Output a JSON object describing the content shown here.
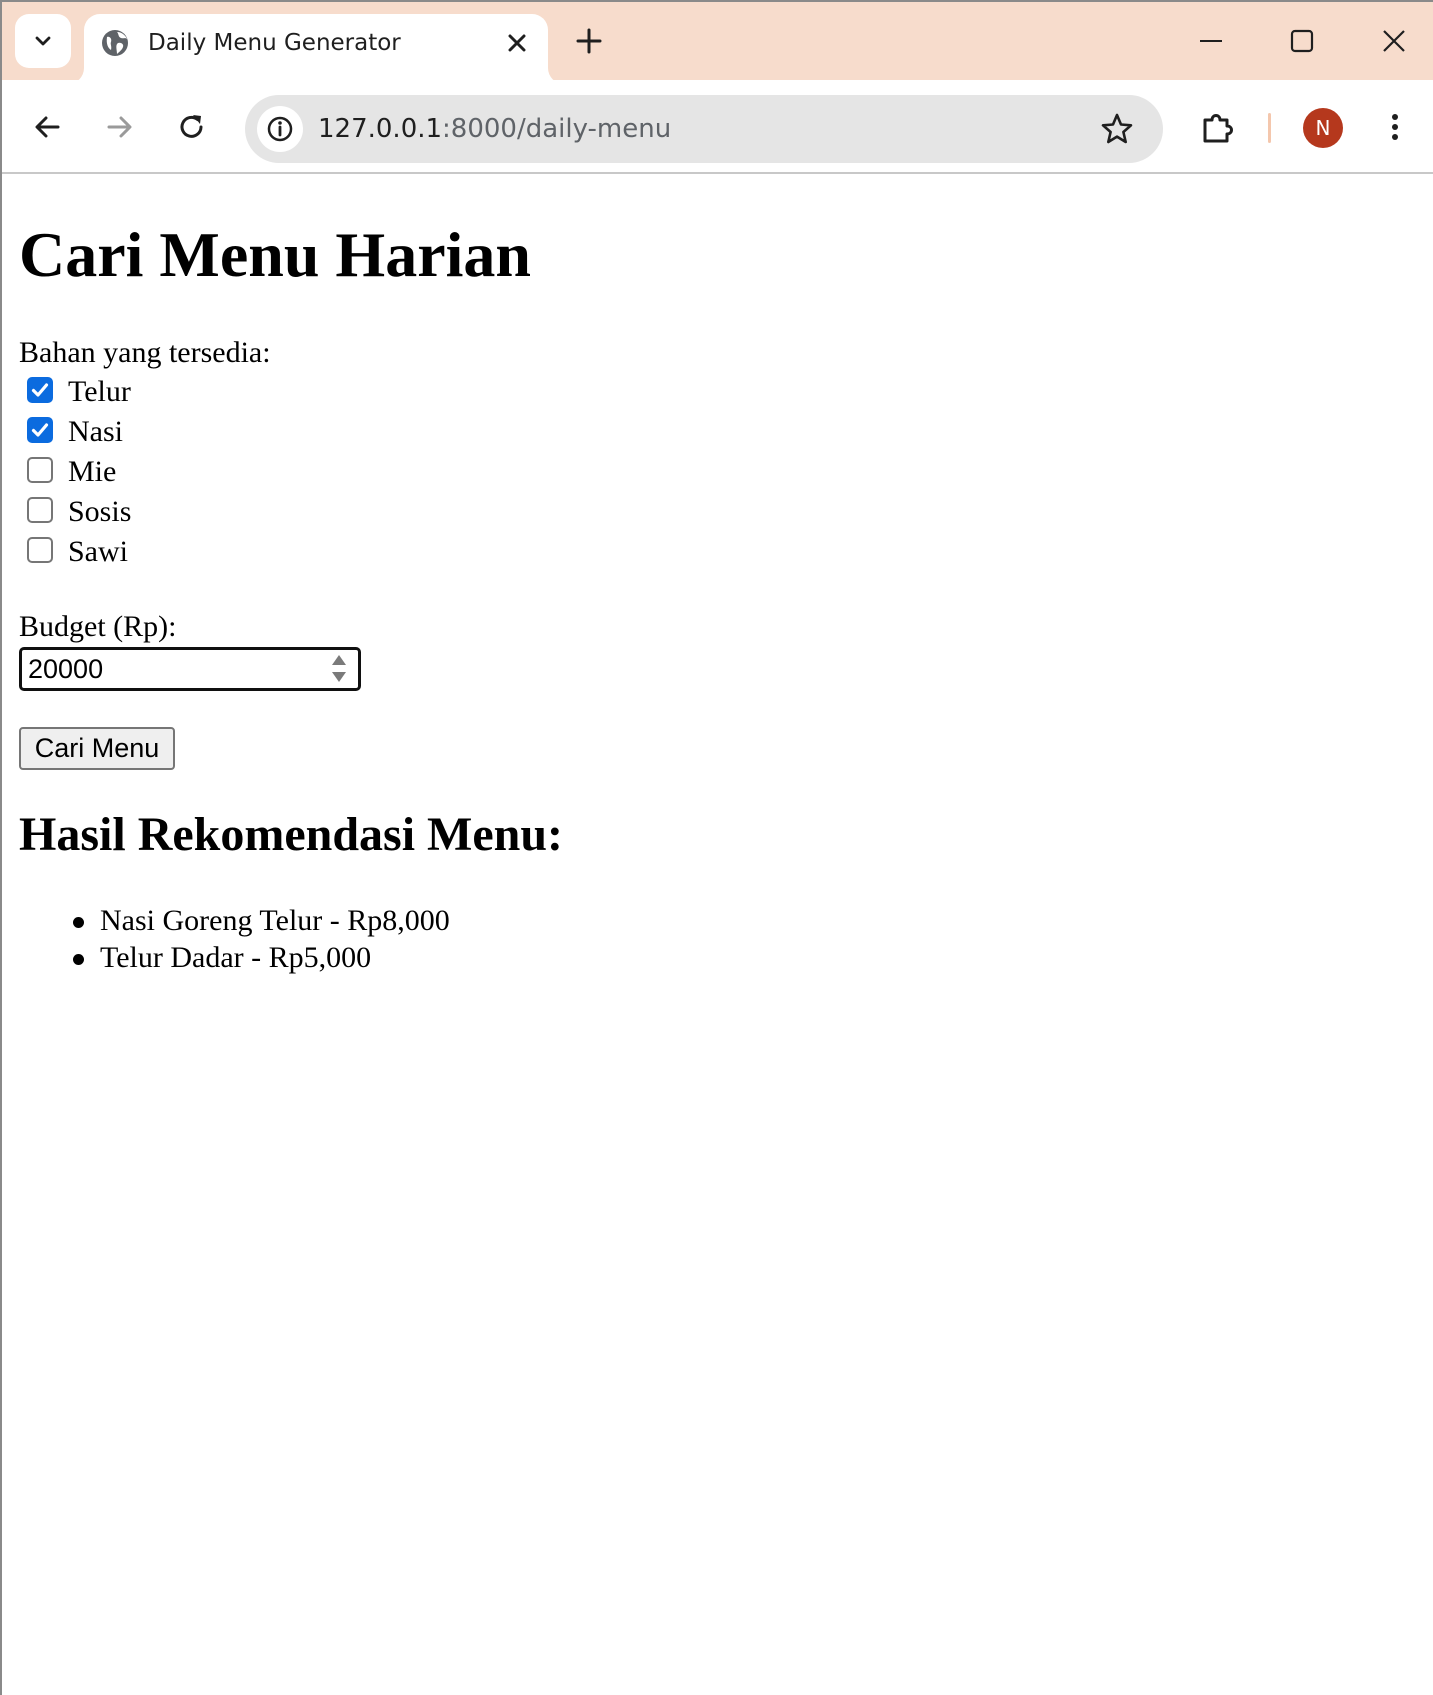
{
  "browser": {
    "tab": {
      "title": "Daily Menu Generator",
      "favicon": "globe-icon"
    },
    "address_bar": {
      "host": "127.0.0.1",
      "path": ":8000/daily-menu"
    },
    "profile_initial": "N",
    "colors": {
      "tabstrip": "#f7dccc",
      "avatar": "#b5381d",
      "checkbox_checked": "#0b6bdf"
    }
  },
  "page": {
    "heading": "Cari Menu Harian",
    "ingredients_label": "Bahan yang tersedia:",
    "ingredients": [
      {
        "label": "Telur",
        "checked": true
      },
      {
        "label": "Nasi",
        "checked": true
      },
      {
        "label": "Mie",
        "checked": false
      },
      {
        "label": "Sosis",
        "checked": false
      },
      {
        "label": "Sawi",
        "checked": false
      }
    ],
    "budget_label": "Budget (Rp):",
    "budget_value": "20000",
    "submit_label": "Cari Menu",
    "results_heading": "Hasil Rekomendasi Menu:",
    "results": [
      "Nasi Goreng Telur - Rp8,000",
      "Telur Dadar - Rp5,000"
    ]
  }
}
